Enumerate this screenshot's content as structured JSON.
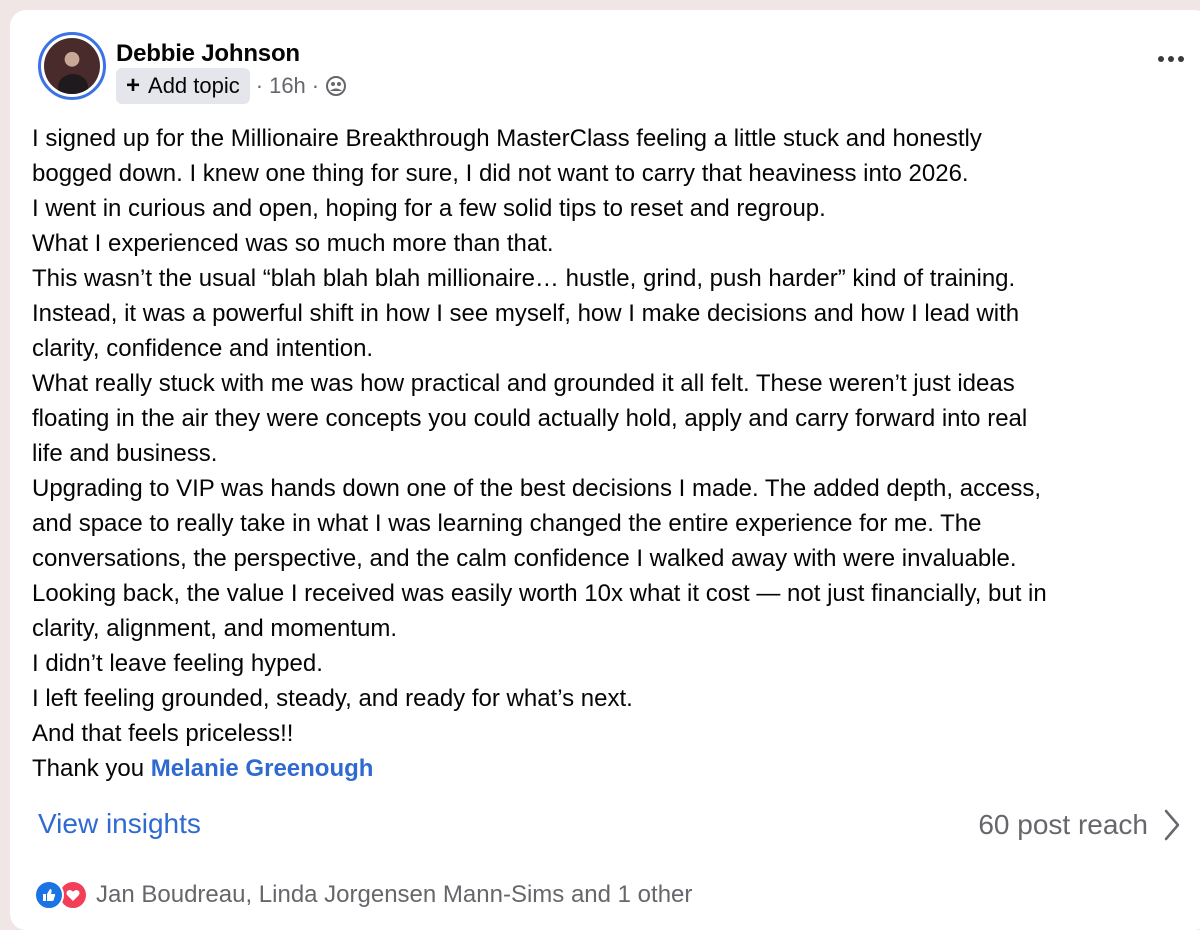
{
  "post": {
    "author": "Debbie Johnson",
    "add_topic_label": "Add topic",
    "separator": "·",
    "time": "16h",
    "audience_icon": "group-audience-icon",
    "body_lines": [
      "I signed up for the Millionaire Breakthrough MasterClass feeling a little stuck and honestly",
      "bogged down. I knew one thing for sure, I did not want to carry that heaviness into 2026.",
      "I went in curious and open, hoping for a few solid tips to reset and regroup.",
      "What I experienced was so much more than that.",
      "This wasn’t the usual “blah blah blah millionaire… hustle, grind, push harder” kind of training.",
      "Instead, it was a powerful shift in how I see myself, how I make decisions and how I lead with",
      "clarity, confidence and intention.",
      "What really stuck with me was how practical and grounded it all felt. These weren’t just ideas",
      "floating in the air they were concepts you could actually hold, apply and carry forward into real",
      "life and business.",
      "Upgrading to VIP was hands down one of the best decisions I made. The added depth, access,",
      "and space to really take in what I was learning changed the entire experience for me. The",
      "conversations, the perspective, and the calm confidence I walked away with were invaluable.",
      "Looking back, the value I received was easily worth 10x what it cost — not just financially, but in",
      "clarity, alignment, and momentum.",
      "I didn’t leave feeling hyped.",
      "I left feeling grounded, steady, and ready for what’s next.",
      "And that feels priceless!!"
    ],
    "thanks_prefix": "Thank you ",
    "mention": "Melanie Greenough"
  },
  "footer": {
    "insights_label": "View insights",
    "reach_label": "60 post reach"
  },
  "reactions": {
    "icons": [
      "like-icon",
      "love-icon"
    ],
    "text": "Jan Boudreau, Linda Jorgensen Mann-Sims and 1 other"
  },
  "colors": {
    "link": "#2f6ad1",
    "avatar_ring": "#3b73e6",
    "muted": "#65676b",
    "like": "#1b74e4",
    "love": "#f33e58"
  }
}
